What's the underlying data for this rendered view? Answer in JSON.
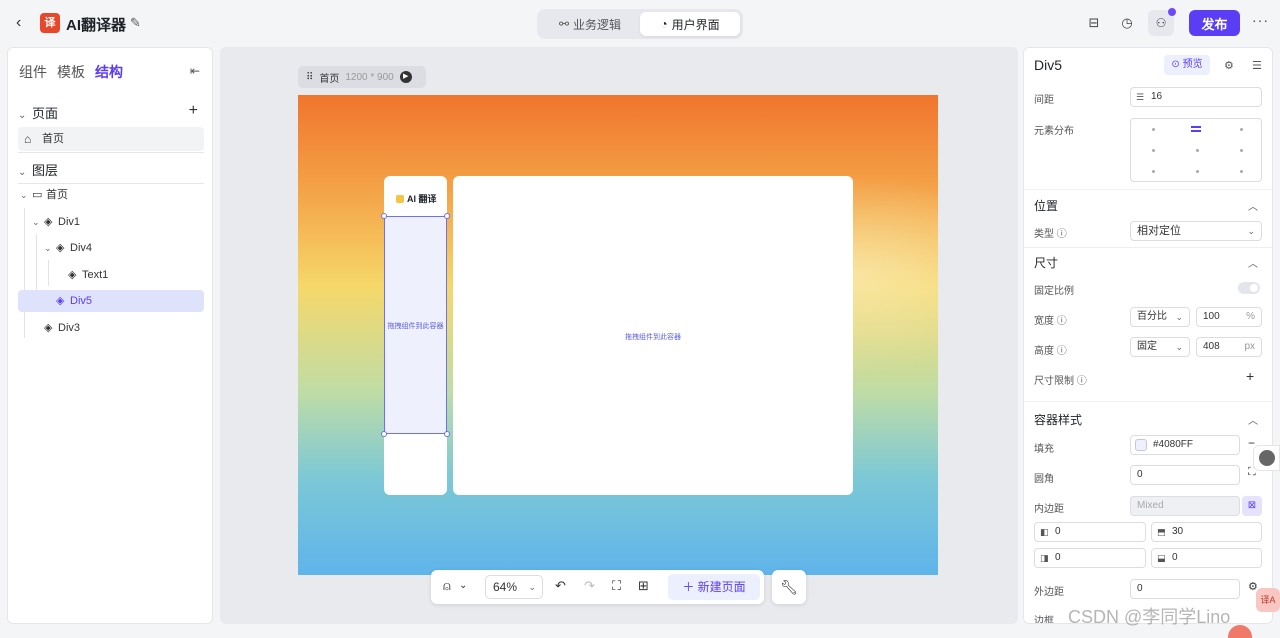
{
  "topbar": {
    "app_title": "AI翻译器",
    "app_logo_text": "译",
    "mode_tabs": [
      "业务逻辑",
      "用户界面"
    ],
    "active_mode": "用户界面",
    "publish_label": "发布"
  },
  "left_panel": {
    "tabs": [
      "组件",
      "模板",
      "结构"
    ],
    "active_tab": "结构",
    "pages_section": "页面",
    "pages": [
      "首页"
    ],
    "layers_section": "图层",
    "layers": [
      "首页",
      "Div1",
      "Div4",
      "Text1",
      "Div5",
      "Div3"
    ],
    "selected_layer": "Div5"
  },
  "canvas": {
    "page_name": "首页",
    "page_size": "1200 * 900",
    "brand_text": "AI 翻译",
    "drop_hint": "拖拽组件到此容器",
    "zoom": "64%",
    "new_page_label": "新建页面"
  },
  "right_panel": {
    "title": "Div5",
    "preview_label": "预览",
    "spacing_label": "间距",
    "spacing_value": "16",
    "distribution_label": "元素分布",
    "position_section": "位置",
    "type_label": "类型",
    "type_value": "相对定位",
    "size_section": "尺寸",
    "fixed_ratio_label": "固定比例",
    "width_label": "宽度",
    "width_mode": "百分比",
    "width_value": "100",
    "width_unit": "%",
    "height_label": "高度",
    "height_mode": "固定",
    "height_value": "408",
    "height_unit": "px",
    "size_limit_label": "尺寸限制",
    "container_style_section": "容器样式",
    "fill_label": "填充",
    "fill_value": "#4080FF",
    "radius_label": "圆角",
    "radius_value": "0",
    "padding_label": "内边距",
    "padding_placeholder": "Mixed",
    "padding_left": "0",
    "padding_top": "30",
    "padding_right": "0",
    "padding_bottom": "0",
    "margin_label": "外边距",
    "margin_value": "0",
    "border_label": "边框"
  },
  "watermark": "CSDN @李同学Lino",
  "colors": {
    "accent": "#5b3df5",
    "selection": "#6d72e8"
  }
}
